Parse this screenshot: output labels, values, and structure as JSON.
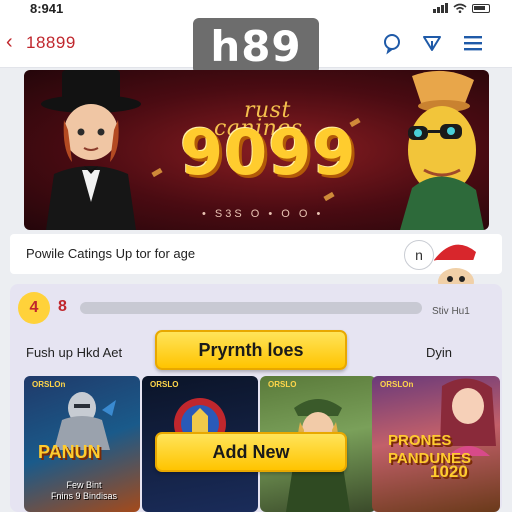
{
  "status_bar": {
    "time": "8:941"
  },
  "header": {
    "back_number": "18899",
    "logo_text": "h89"
  },
  "banner": {
    "subtitle": "rust\ncanines",
    "amount": "9099",
    "dots": "• S3S O • O O •"
  },
  "notice": {
    "text": "Powile Catings Up tor for age",
    "button_label": "n"
  },
  "progress": {
    "level": "4",
    "count": "8",
    "value_fraction": 0.0,
    "caption": "Stiv Hu1"
  },
  "section": {
    "left_label": "Fush up Hkd Aet",
    "right_label": "Dyin",
    "primary_button": "Pryrnth loes",
    "add_button": "Add New"
  },
  "games": [
    {
      "tag": "ORSLOn",
      "title": "PANUN",
      "subtitle": "Few Bint\nFnins 9 Bindisas"
    },
    {
      "tag": "ORSLO"
    },
    {
      "tag": "ORSLO"
    },
    {
      "tag": "ORSLOn",
      "title": "PRONES\nPANDUNES",
      "year": "1020"
    }
  ],
  "colors": {
    "accent_red": "#c0272d",
    "button_yellow": "#ffc400",
    "logo_gray": "#6d6d6d"
  },
  "icons": [
    "back-chevron-icon",
    "chat-bubble-icon",
    "send-icon",
    "menu-icon",
    "wifi-icon",
    "battery-icon"
  ]
}
